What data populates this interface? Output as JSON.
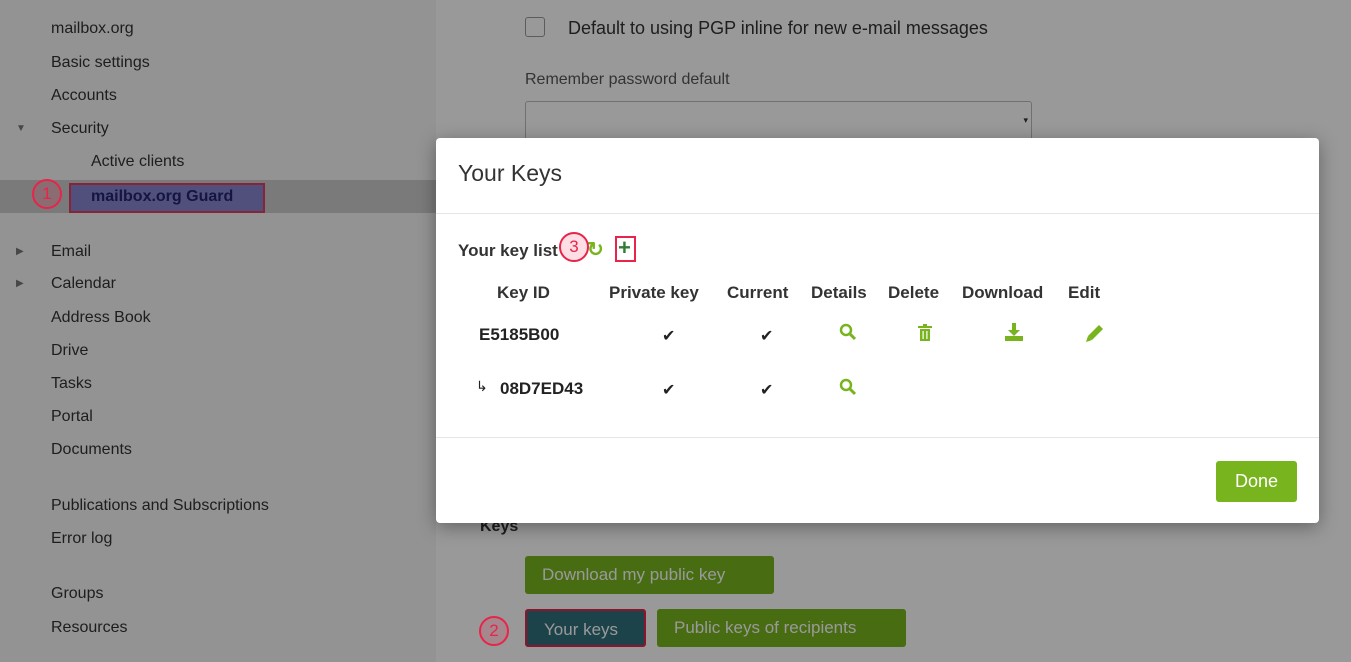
{
  "sidebar": {
    "items": [
      {
        "label": "mailbox.org"
      },
      {
        "label": "Basic settings"
      },
      {
        "label": "Accounts"
      },
      {
        "label": "Security"
      },
      {
        "label": "Active clients"
      },
      {
        "label": "mailbox.org Guard"
      },
      {
        "label": "Email"
      },
      {
        "label": "Calendar"
      },
      {
        "label": "Address Book"
      },
      {
        "label": "Drive"
      },
      {
        "label": "Tasks"
      },
      {
        "label": "Portal"
      },
      {
        "label": "Documents"
      },
      {
        "label": "Publications and Subscriptions"
      },
      {
        "label": "Error log"
      },
      {
        "label": "Groups"
      },
      {
        "label": "Resources"
      }
    ]
  },
  "main": {
    "pgp_inline_label": "Default to using PGP inline for new e-mail messages",
    "remember_password_label": "Remember password default",
    "keys_heading": "Keys",
    "download_public_key_label": "Download my public key",
    "your_keys_label": "Your keys",
    "public_keys_recipients_label": "Public keys of recipients"
  },
  "modal": {
    "title": "Your Keys",
    "key_list_label": "Your key list",
    "columns": [
      "Key ID",
      "Private key",
      "Current",
      "Details",
      "Delete",
      "Download",
      "Edit"
    ],
    "rows": [
      {
        "key_id": "E5185B00",
        "private": "✔",
        "current": "✔",
        "details": "search-icon",
        "delete": "trash-icon",
        "download": "download-icon",
        "edit": "pencil-icon"
      },
      {
        "key_id": "08D7ED43",
        "subkey_arrow": "↳",
        "private": "✔",
        "current": "✔",
        "details": "search-icon"
      }
    ],
    "done_label": "Done"
  },
  "markers": {
    "one": "1",
    "two": "2",
    "three": "3"
  },
  "colors": {
    "accent_green": "#77b41e",
    "highlight_red": "#e8244a",
    "selected_button": "#2f6f7c"
  }
}
